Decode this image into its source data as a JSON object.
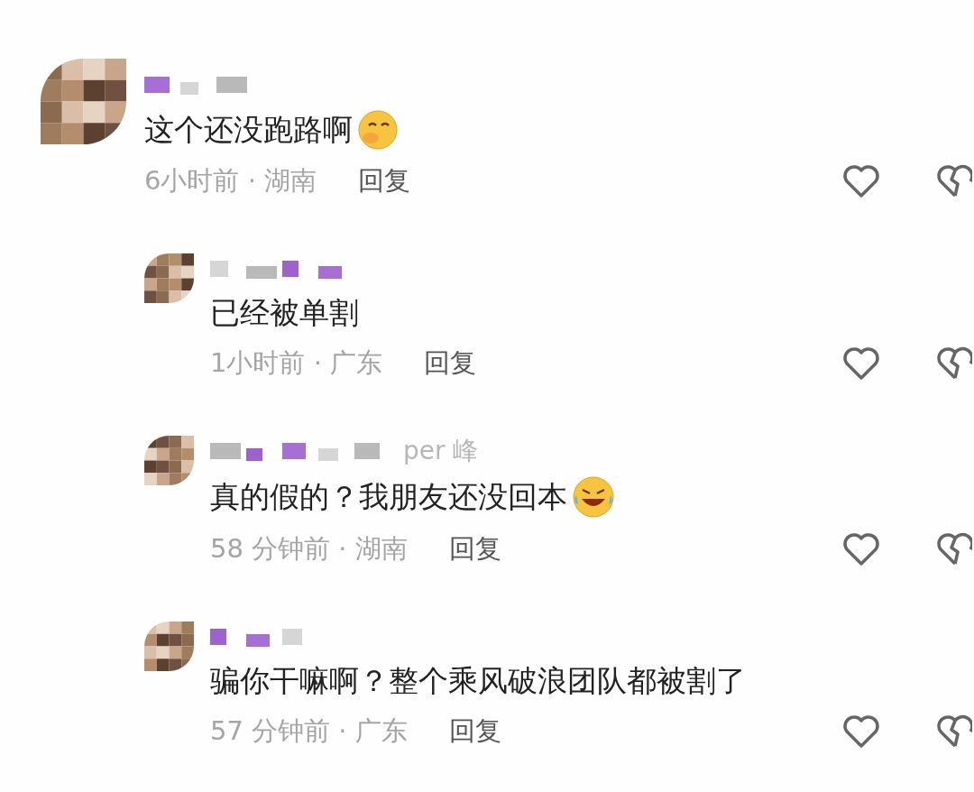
{
  "comments": [
    {
      "text": "这个还没跑路啊",
      "emoji": {
        "kind": "shy"
      },
      "meta": "6小时前 · 湖南",
      "reply_label": "回复",
      "replies": [
        {
          "text": "已经被单割",
          "meta": "1小时前 · 广东",
          "reply_label": "回复"
        },
        {
          "author_tail": "per 峰",
          "text": "真的假的？我朋友还没回本",
          "emoji": {
            "kind": "laugh"
          },
          "meta": "58 分钟前 · 湖南",
          "reply_label": "回复"
        },
        {
          "text": "骗你干嘛啊？整个乘风破浪团队都被割了",
          "meta": "57 分钟前 · 广东",
          "reply_label": "回复"
        }
      ]
    }
  ]
}
